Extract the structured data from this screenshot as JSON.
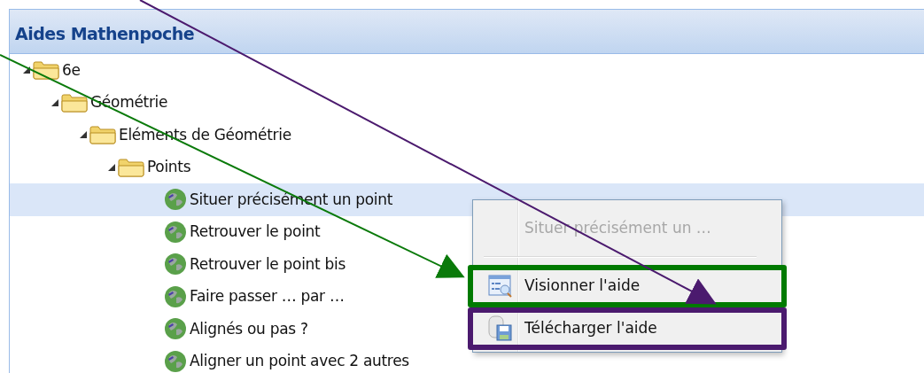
{
  "panel": {
    "title": "Aides Mathenpoche"
  },
  "tree": [
    {
      "label": "6e",
      "kind": "folder",
      "expanded": true,
      "selected": false,
      "children": [
        {
          "label": "Géométrie",
          "kind": "folder",
          "expanded": true,
          "selected": false,
          "children": [
            {
              "label": "Eléments de Géométrie",
              "kind": "folder",
              "expanded": true,
              "selected": false,
              "children": [
                {
                  "label": "Points",
                  "kind": "folder",
                  "expanded": true,
                  "selected": false,
                  "children": [
                    {
                      "label": "Situer précisément un point",
                      "kind": "leaf",
                      "selected": true
                    },
                    {
                      "label": "Retrouver le point",
                      "kind": "leaf",
                      "selected": false
                    },
                    {
                      "label": "Retrouver le point bis",
                      "kind": "leaf",
                      "selected": false
                    },
                    {
                      "label": "Faire passer … par …",
                      "kind": "leaf",
                      "selected": false
                    },
                    {
                      "label": "Alignés ou pas ?",
                      "kind": "leaf",
                      "selected": false
                    },
                    {
                      "label": "Aligner un point avec 2 autres",
                      "kind": "leaf",
                      "selected": false
                    }
                  ]
                }
              ]
            }
          ]
        }
      ]
    }
  ],
  "context_menu": {
    "items": [
      {
        "label": "Situer précisément un …",
        "kind": "title",
        "disabled": true
      },
      {
        "label": "Visionner l'aide",
        "kind": "view",
        "disabled": false,
        "color": "#007a00"
      },
      {
        "label": "Télécharger l'aide",
        "kind": "download",
        "disabled": false,
        "color": "#4b1a6e"
      }
    ]
  }
}
